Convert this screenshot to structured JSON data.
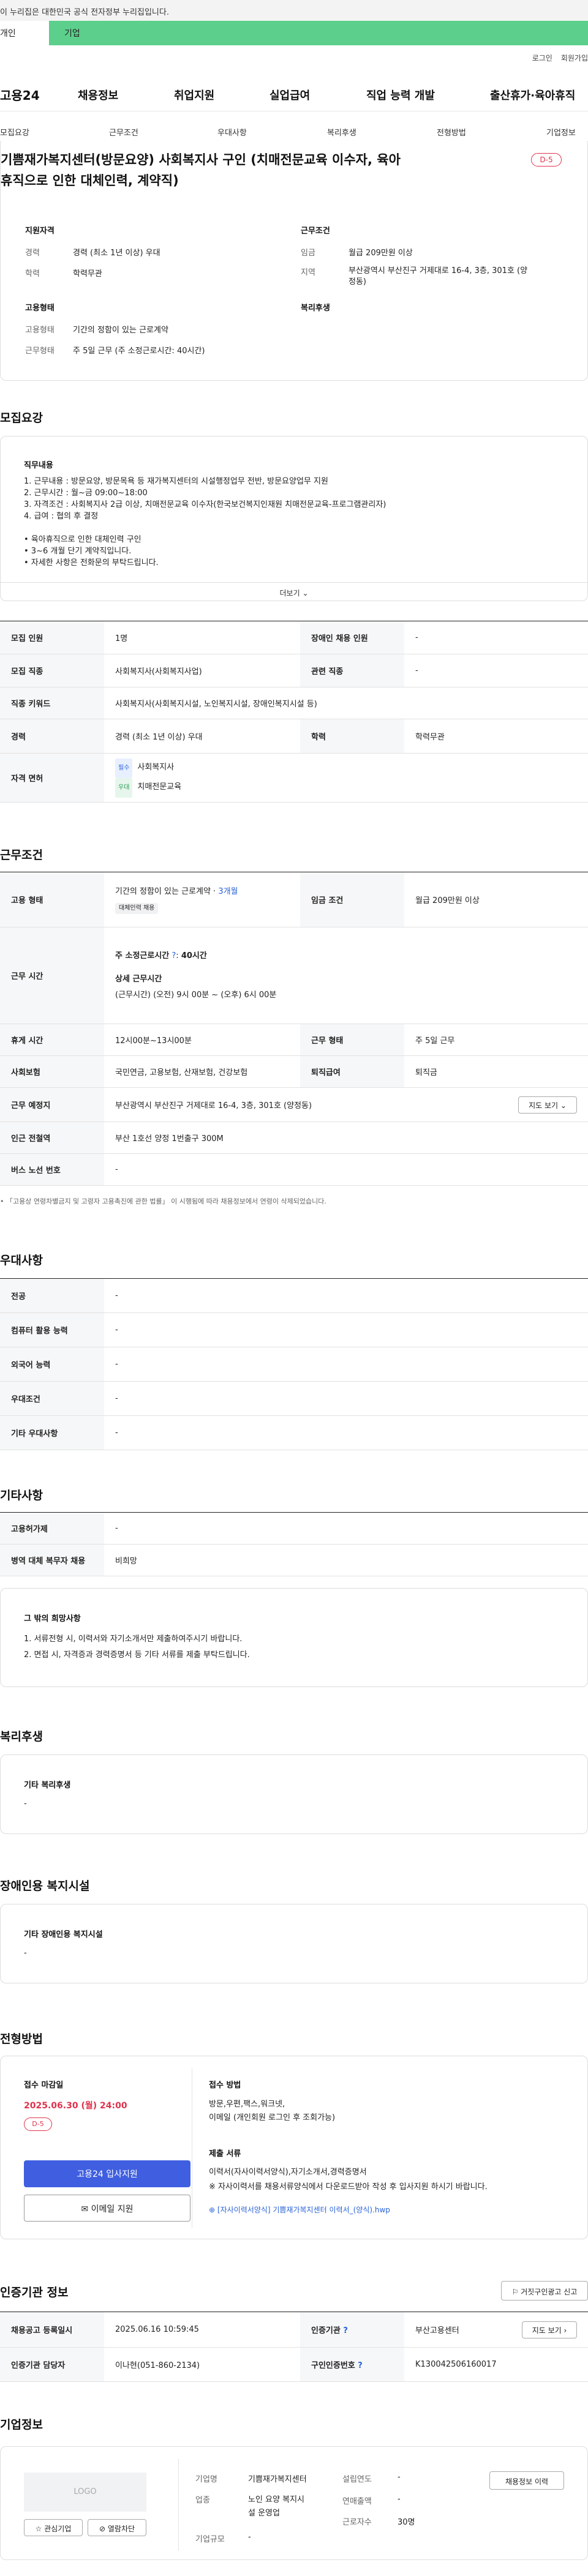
{
  "gov_banner": "이 누리집은 대한민국 공식 전자정부 누리집입니다.",
  "top_tabs": [
    "개인",
    "기업"
  ],
  "util": [
    "로그인",
    "회원가입"
  ],
  "logo": "고용24",
  "main_menu": [
    "채용정보",
    "취업지원",
    "실업급여",
    "직업 능력 개발",
    "출산휴가·육아휴직"
  ],
  "sub_menu": [
    "모집요강",
    "근무조건",
    "우대사항",
    "복리후생",
    "전형방법",
    "기업정보"
  ],
  "job": {
    "title_line1": "기쁨재가복지센터(방문요양) 사회복지사 구인 (치매전문교육 이수자, 육아",
    "title_line2": "휴직으로 인한 대체인력, 계약직)",
    "dday": "D-5",
    "qual_head": "지원자격",
    "cond_head": "근무조건",
    "type_head": "고용형태",
    "welfare_head": "복리후생",
    "career_lbl": "경력",
    "career": "경력 (최소 1년 이상) 우대",
    "edu_lbl": "학력",
    "edu": "학력무관",
    "wage_lbl": "임금",
    "wage": "월급 209만원 이상",
    "region_lbl": "지역",
    "region1": "부산광역시 부산진구 거제대로 16-4, 3층, 301호 (양",
    "region2": "정동)",
    "emp_lbl": "고용형태",
    "emp": "기간의 정함이 있는 근로계약",
    "work_lbl": "근무형태",
    "work": "주 5일 근무 (주 소정근로시간: 40시간)"
  },
  "recruit": {
    "title": "모집요강",
    "box_title": "직무내용",
    "lines": [
      "1. 근무내용 :  방문요양, 방문목욕 등 재가복지센터의 시설행정업무 전반, 방문요양업무 지원",
      "2. 근무시간 :  월~금 09:00~18:00",
      "3. 자격조건 :  사회복지사 2급 이상, 치매전문교육 이수자(한국보건복지인재원 치매전문교육-프로그램관리자)",
      "4. 급여 :  협의 후 결정",
      "",
      "• 육아휴직으로 인한 대체인력 구인",
      "• 3~6 개월 단기 계약직입니다.",
      "• 자세한 사항은 전화문의 부탁드립니다."
    ],
    "more": "더보기",
    "rows": {
      "count_h": "모집 인원",
      "count": "1명",
      "dis_h": "장애인 채용 인원",
      "dis": "-",
      "job_h": "모집 직종",
      "job": "사회복지사(사회복지사업)",
      "rel_h": "관련 직종",
      "rel": "-",
      "kw_h": "직종 키워드",
      "kw": "사회복지사(사회복지시설, 노인복지시설, 장애인복지시설 등)",
      "car_h": "경력",
      "car": "경력 (최소 1년 이상) 우대",
      "edu_h": "학력",
      "edu": "학력무관",
      "lic_h": "자격 면허",
      "lic1_badge": "필수",
      "lic1": "사회복지사",
      "lic2_badge": "우대",
      "lic2": "치매전문교육"
    }
  },
  "conditions": {
    "title": "근무조건",
    "emp_h": "고용 형태",
    "emp": "기간의 정함이 있는 근로계약 · ",
    "emp_months": "3개월",
    "emp_tag": "대체인력 채용",
    "wage_h": "임금 조건",
    "wage": "월급 209만원 이상",
    "time_h": "근무 시간",
    "time1": "주 소정근로시간",
    "time1_val": "40시간",
    "time2": "상세 근무시간",
    "time3": "(근무시간) (오전) 9시 00분 ~ (오후) 6시 00분",
    "rest_h": "휴게 시간",
    "rest": "12시00분~13시00분",
    "shape_h": "근무 형태",
    "shape": "주 5일 근무",
    "ins_h": "사회보험",
    "ins": "국민연금, 고용보험, 산재보험, 건강보험",
    "ret_h": "퇴직급여",
    "ret": "퇴직금",
    "loc_h": "근무 예정지",
    "loc": "부산광역시 부산진구 거제대로 16-4, 3층, 301호 (양정동)",
    "map": "지도 보기",
    "sub_h": "인근 전철역",
    "sub": "부산 1호선 양정 1번출구 300M",
    "bus_h": "버스 노선 번호",
    "bus": "-",
    "note": "• 「고용상 연령차별금지 및 고령자 고용촉진에 관한 법률」 이 시행됨에 따라 채용정보에서 연령이 삭제되었습니다."
  },
  "pref": {
    "title": "우대사항",
    "rows": [
      [
        "전공",
        "-"
      ],
      [
        "컴퓨터 활용 능력",
        "-"
      ],
      [
        "외국어 능력",
        "-"
      ],
      [
        "우대조건",
        "-"
      ],
      [
        "기타 우대사항",
        "-"
      ]
    ]
  },
  "etc": {
    "title": "기타사항",
    "rows": [
      [
        "고용허가제",
        "-"
      ],
      [
        "병역 대체 복무자 채용",
        "비희망"
      ]
    ],
    "box_title": "그 밖의 희망사항",
    "lines": [
      "1. 서류전형 시, 이력서와 자기소개서만 제출하여주시기 바랍니다.",
      "2. 면접 시, 자격증과 경력증명서 등 기타 서류를 제출 부탁드립니다."
    ]
  },
  "welfare": {
    "title": "복리후생",
    "box_title": "기타 복리후생",
    "val": "-"
  },
  "disfac": {
    "title": "장애인용 복지시설",
    "box_title": "기타 장애인용 복지시설",
    "val": "-"
  },
  "selection": {
    "title": "전형방법",
    "deadline_lbl": "접수 마감일",
    "deadline": "2025.06.30 (월) 24:00",
    "dday": "D-5",
    "apply_btn": "고용24 입사지원",
    "email_btn": "이메일 지원",
    "method_h": "접수 방법",
    "method1": "방문,우편,팩스,워크넷,",
    "method2": "이메일 (개인회원 로그인 후 조회가능)",
    "docs_h": "제출 서류",
    "docs1": "이력서(자사이력서양식),자기소개서,경력증명서",
    "docs2": "※ 자사이력서를 채용서류양식에서 다운로드받아 작성 후 입사지원 하시기 바랍니다.",
    "file": "[자사이력서양식] 기쁨재가복지센터 이력서_(양식).hwp"
  },
  "cert": {
    "title": "인증기관 정보",
    "report": "거짓구인광고 신고",
    "reg_h": "채용공고 등록일시",
    "reg": "2025.06.16 10:59:45",
    "org_h": "인증기관",
    "org": "부산고용센터",
    "map": "지도 보기",
    "mgr_h": "인증기관 담당자",
    "mgr": "이나현(051-860-2134)",
    "no_h": "구인인증번호",
    "no": "K130042506160017"
  },
  "company": {
    "title": "기업정보",
    "logo": "LOGO",
    "fav": "관심기업",
    "block": "열람차단",
    "name_lbl": "기업명",
    "name": "기쁨재가복지센터",
    "ind_lbl": "업종",
    "ind1": "노인 요양 복지시",
    "ind2": "설 운영업",
    "size_lbl": "기업규모",
    "size": "-",
    "year_lbl": "설립연도",
    "year": "-",
    "sales_lbl": "연매출액",
    "sales": "-",
    "emp_lbl": "근로자수",
    "emp": "30명",
    "hist_btn": "채용정보 이력"
  }
}
